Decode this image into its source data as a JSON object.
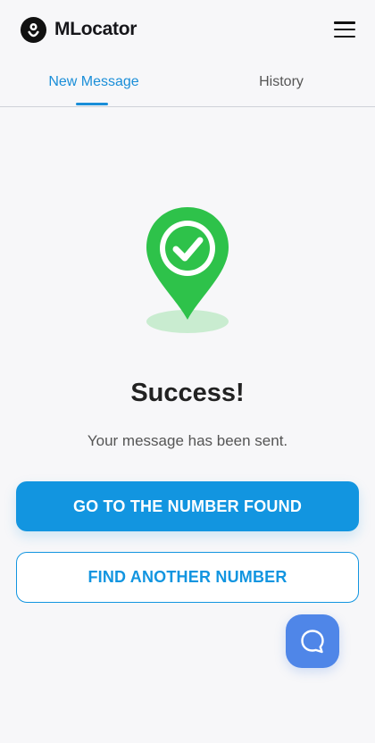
{
  "header": {
    "brand": "MLocator",
    "logo_icon": "map-pin-logo-icon",
    "menu_icon": "hamburger-menu-icon"
  },
  "tabs": [
    {
      "label": "New Message",
      "active": true
    },
    {
      "label": "History",
      "active": false
    }
  ],
  "main": {
    "illustration_icon": "location-pin-check-icon",
    "title": "Success!",
    "subtitle": "Your message has been sent.",
    "primary_button": "GO TO THE NUMBER FOUND",
    "secondary_button": "FIND ANOTHER NUMBER"
  },
  "chat": {
    "icon": "chat-bubble-icon"
  },
  "colors": {
    "accent": "#1295e0",
    "success": "#2ec24a",
    "chat": "#4f86e8",
    "background": "#f7f7f9"
  }
}
